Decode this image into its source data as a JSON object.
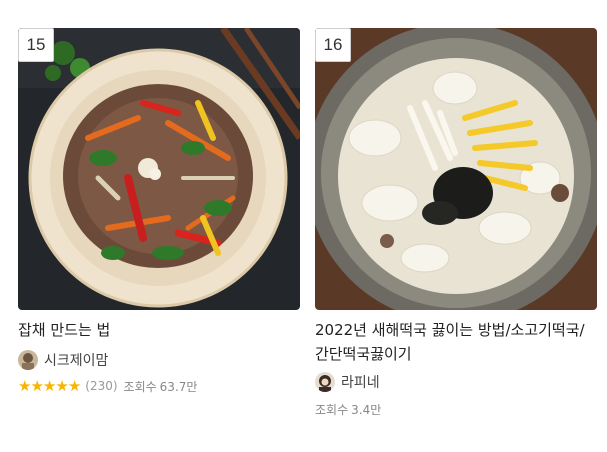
{
  "recipes": [
    {
      "rank": "15",
      "title": "잡채 만드는 법",
      "author": "시크제이맘",
      "rating_stars": 5,
      "review_count": "(230)",
      "views_label": "조회수",
      "views": "63.7만"
    },
    {
      "rank": "16",
      "title_line1": "2022년 새해떡국 끓이는 방법/소고기떡국/",
      "title_line2": "간단떡국끓이기",
      "author": "라피네",
      "views_label": "조회수",
      "views": "3.4만"
    }
  ],
  "colors": {
    "star": "#f8b500",
    "meta_text": "#888888"
  },
  "icons": {
    "rank_badge": "rank-badge",
    "star": "star-icon"
  }
}
